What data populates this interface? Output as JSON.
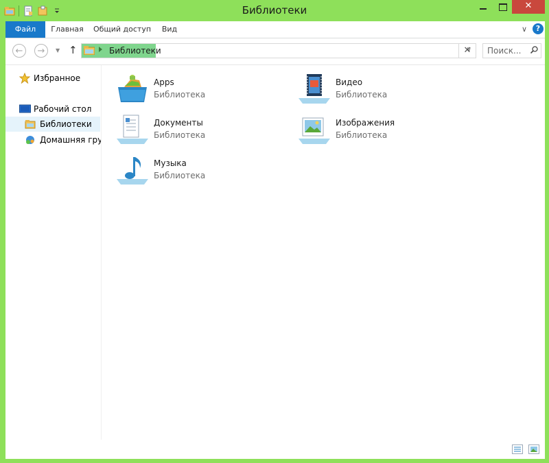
{
  "window": {
    "title": "Библиотеки",
    "close_glyph": "✕"
  },
  "ribbon": {
    "tabs": [
      "Файл",
      "Главная",
      "Общий доступ",
      "Вид"
    ],
    "help_label": "?",
    "expand_glyph": "∨"
  },
  "navigation": {
    "back_glyph": "←",
    "forward_glyph": "→",
    "recent_glyph": "▼",
    "up_glyph": "↑",
    "address_path": "Библиотеки",
    "address_dropdown_glyph": "∨",
    "refresh_glyph": "✕",
    "search_placeholder": "Поиск..."
  },
  "sidebar": {
    "items": [
      {
        "label": "Избранное",
        "icon": "star-icon"
      },
      {
        "label": "Рабочий стол",
        "icon": "desktop-icon"
      },
      {
        "label": "Библиотеки",
        "icon": "library-folder-icon",
        "selected": true
      },
      {
        "label": "Домашняя группа",
        "icon": "homegroup-icon"
      }
    ]
  },
  "libraries": [
    {
      "name": "Apps",
      "type": "Библиотека",
      "icon": "apps-library-icon"
    },
    {
      "name": "Видео",
      "type": "Библиотека",
      "icon": "video-library-icon"
    },
    {
      "name": "Документы",
      "type": "Библиотека",
      "icon": "documents-library-icon"
    },
    {
      "name": "Изображения",
      "type": "Библиотека",
      "icon": "pictures-library-icon"
    },
    {
      "name": "Музыка",
      "type": "Библиотека",
      "icon": "music-library-icon"
    }
  ],
  "colors": {
    "frame": "#8ee05a",
    "accent": "#1979ca",
    "close": "#c9483d",
    "address_highlight": "#7fd58d",
    "selection": "#e5f3fb"
  },
  "status": {
    "view_buttons": [
      "details-view-icon",
      "large-icons-view-icon"
    ]
  }
}
